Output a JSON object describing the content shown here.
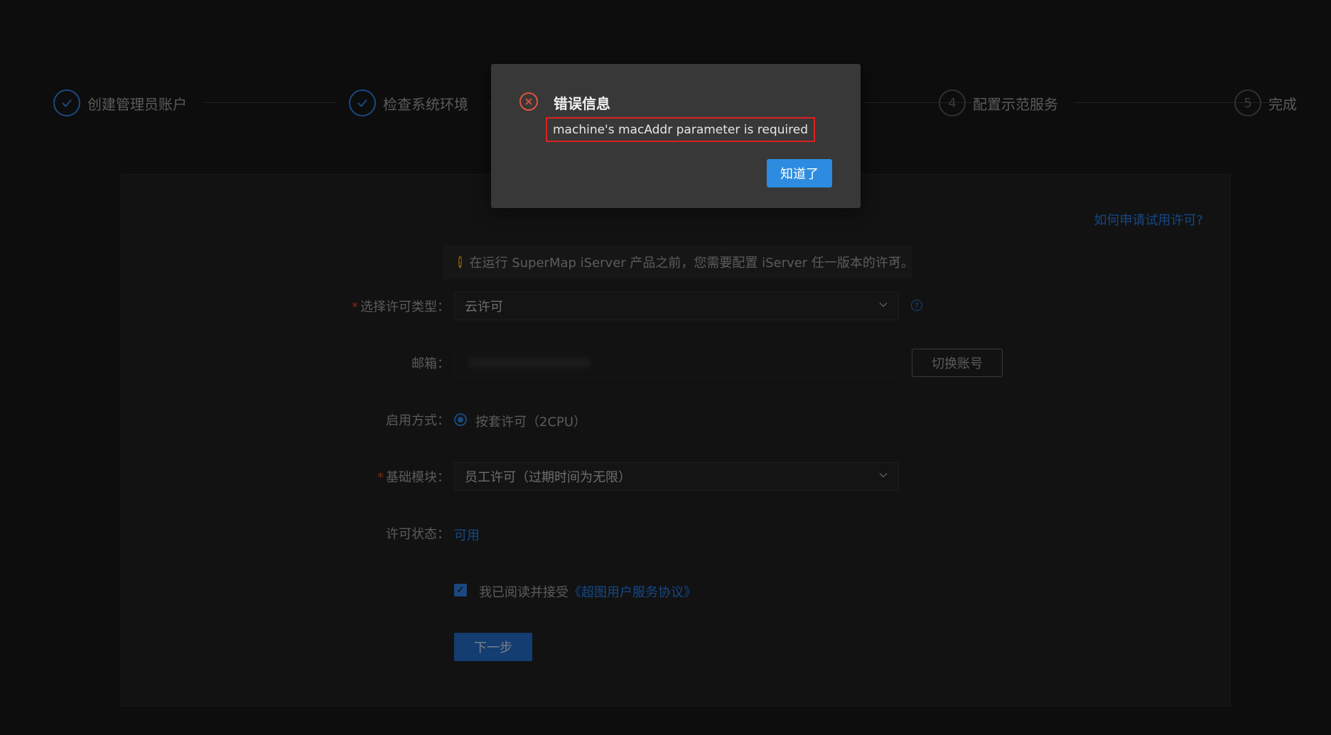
{
  "steps": [
    {
      "label": "创建管理员账户",
      "status": "done",
      "icon": "check-icon"
    },
    {
      "label": "检查系统环境",
      "status": "done",
      "icon": "check-icon"
    },
    {
      "label": "配置示范服务",
      "status": "todo",
      "number": "4"
    },
    {
      "label": "完成",
      "status": "todo",
      "number": "5"
    }
  ],
  "help_link": "如何申请试用许可?",
  "alert": {
    "icon": "warning-icon",
    "text": "在运行 SuperMap iServer 产品之前，您需要配置 iServer 任一版本的许可。",
    "close": "×"
  },
  "form": {
    "license_type_label": "选择许可类型",
    "license_type_value": "云许可",
    "email_label": "邮箱",
    "switch_account_label": "切换账号",
    "enable_mode_label": "启用方式",
    "enable_mode_option": "按套许可（2CPU）",
    "base_module_label": "基础模块",
    "base_module_value": "员工许可（过期时间为无限）",
    "license_status_label": "许可状态",
    "license_status_value": "可用",
    "agree_text": "我已阅读并接受",
    "agree_link": "《超图用户服务协议》",
    "next_label": "下一步",
    "colon": "："
  },
  "modal": {
    "icon": "error-circle-icon",
    "title": "错误信息",
    "message": "machine's macAddr parameter is required",
    "ok_label": "知道了"
  },
  "colors": {
    "accent": "#2a6fc4",
    "link": "#1f6fd0",
    "error": "#e0533d",
    "modal_button": "#2d8ce0"
  }
}
